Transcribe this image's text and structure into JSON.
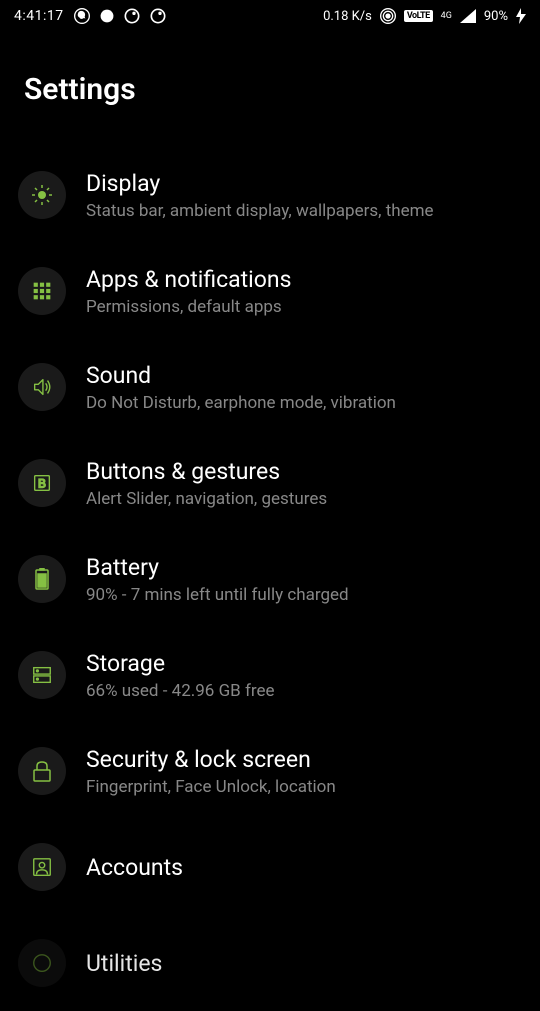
{
  "status": {
    "time": "4:41:17",
    "network_speed": "0.18 K/s",
    "battery": "90%",
    "volte": "VoLTE",
    "signal_label": "4G"
  },
  "header": {
    "title": "Settings"
  },
  "items": [
    {
      "title": "Display",
      "subtitle": "Status bar, ambient display, wallpapers, theme"
    },
    {
      "title": "Apps & notifications",
      "subtitle": "Permissions, default apps"
    },
    {
      "title": "Sound",
      "subtitle": "Do Not Disturb, earphone mode, vibration"
    },
    {
      "title": "Buttons & gestures",
      "subtitle": "Alert Slider, navigation, gestures"
    },
    {
      "title": "Battery",
      "subtitle": "90% - 7 mins left until fully charged"
    },
    {
      "title": "Storage",
      "subtitle": "66% used - 42.96 GB free"
    },
    {
      "title": "Security & lock screen",
      "subtitle": "Fingerprint, Face Unlock, location"
    },
    {
      "title": "Accounts",
      "subtitle": ""
    },
    {
      "title": "Utilities",
      "subtitle": ""
    }
  ],
  "accent_color": "#85c043"
}
